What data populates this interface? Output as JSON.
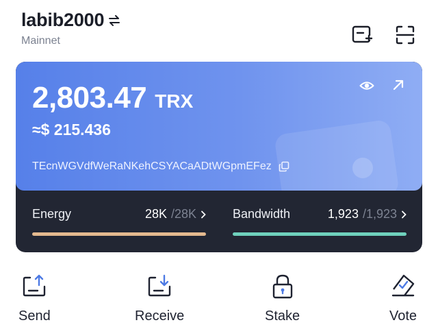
{
  "header": {
    "wallet_name": "labib2000",
    "network": "Mainnet"
  },
  "card": {
    "balance": "2,803.47",
    "unit": "TRX",
    "fiat": "≈$ 215.436",
    "address": "TEcnWGVdfWeRaNKehCSYACaADtWGpmEFez"
  },
  "resources": {
    "energy": {
      "label": "Energy",
      "current": "28K",
      "max": "/28K",
      "color": "#e4b98f"
    },
    "bandwidth": {
      "label": "Bandwidth",
      "current": "1,923",
      "max": "/1,923",
      "color": "#6fd1bd"
    }
  },
  "actions": [
    {
      "label": "Send",
      "icon": "send-icon"
    },
    {
      "label": "Receive",
      "icon": "receive-icon"
    },
    {
      "label": "Stake",
      "icon": "lock-icon"
    },
    {
      "label": "Vote",
      "icon": "vote-icon"
    }
  ],
  "colors": {
    "accent": "#5680e9",
    "card_dark": "#222633"
  }
}
